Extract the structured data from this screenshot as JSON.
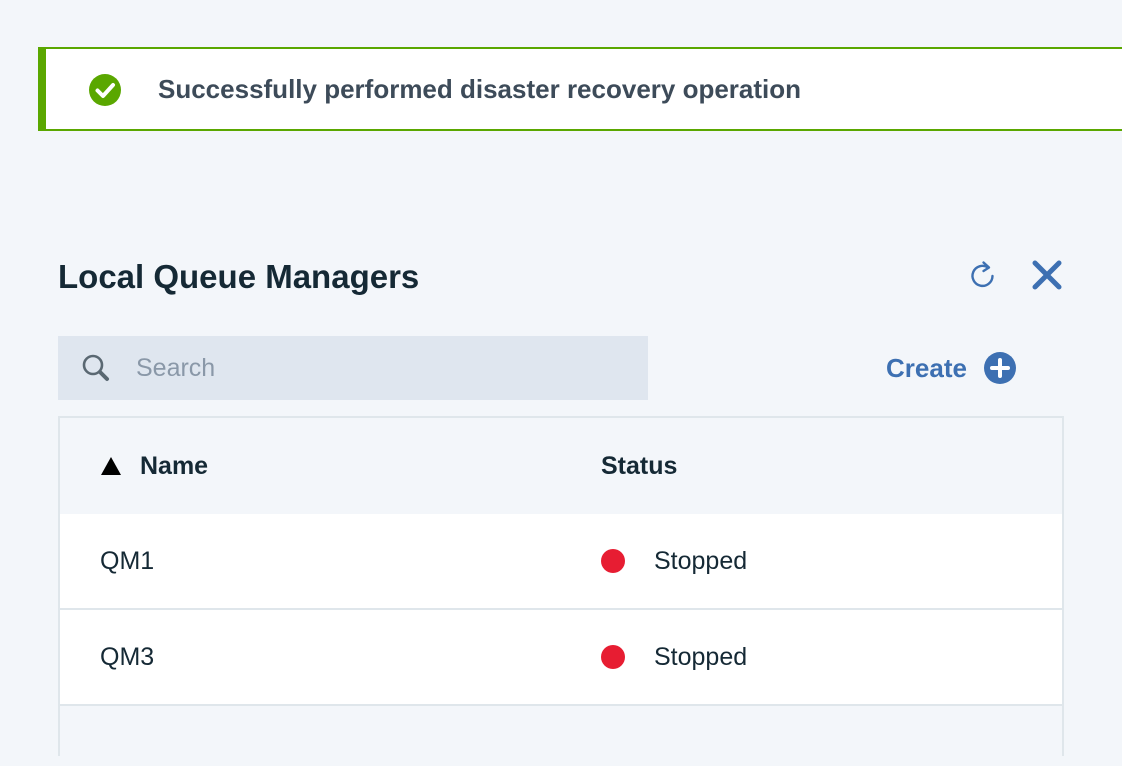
{
  "notification": {
    "message": "Successfully performed disaster recovery operation",
    "icon": "checkmark-filled-icon",
    "color": "#5aa700"
  },
  "panel": {
    "title": "Local Queue Managers",
    "refresh_icon": "refresh-icon",
    "close_icon": "close-icon"
  },
  "search": {
    "placeholder": "Search",
    "value": ""
  },
  "create": {
    "label": "Create",
    "icon": "add-filled-icon",
    "color": "#3d70b2"
  },
  "table": {
    "columns": [
      "Name",
      "Status"
    ],
    "sort": {
      "column": "Name",
      "direction": "ascending"
    },
    "rows": [
      {
        "name": "QM1",
        "status": "Stopped",
        "status_color": "#e71d32"
      },
      {
        "name": "QM3",
        "status": "Stopped",
        "status_color": "#e71d32"
      }
    ]
  }
}
